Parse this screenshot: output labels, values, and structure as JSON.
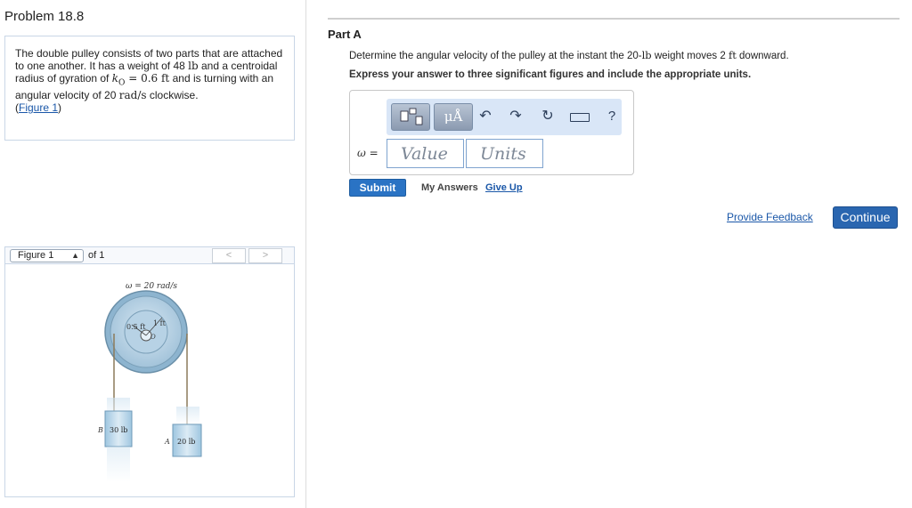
{
  "problem": {
    "title": "Problem 18.8",
    "text_part1": "The double pulley consists of two parts that are attached to one another. It has a weight of 48 ",
    "weight_unit": "lb",
    "text_part2": " and a centroidal radius of gyration of ",
    "k_symbol": "k",
    "k_sub": "O",
    "k_value": " = 0.6 ft",
    "text_part3": " and is turning with an angular velocity of 20 ",
    "omega_unit": "rad/s",
    "text_part4": " clockwise.",
    "figure_link_open": "(",
    "figure_link": "Figure 1",
    "figure_link_close": ")"
  },
  "figure_nav": {
    "select_value": "Figure 1",
    "of_text": "of 1",
    "prev": "<",
    "next": ">"
  },
  "figure": {
    "omega_label": "ω = 20 rad/s",
    "inner_radius_label": "0.5 ft",
    "outer_radius_label": "1 ft",
    "center_label": "O",
    "block_b_label": "B",
    "block_b_weight": "30 lb",
    "block_a_label": "A",
    "block_a_weight": "20 lb"
  },
  "part": {
    "label": "Part A",
    "question_part1": "Determine the angular velocity of the pulley at the instant the 20-",
    "question_unit1": "lb",
    "question_part2": " weight moves 2 ",
    "question_unit2": "ft",
    "question_part3": " downward.",
    "instruction": "Express your answer to three significant figures and include the appropriate units."
  },
  "toolbar": {
    "units_button": "μÅ",
    "undo_icon": "undo-icon",
    "redo_icon": "redo-icon",
    "reset_icon": "reset-icon",
    "keyboard_icon": "keyboard-icon",
    "help": "?"
  },
  "answer": {
    "variable_label": "ω =",
    "value_placeholder": "Value",
    "units_placeholder": "Units"
  },
  "actions": {
    "submit": "Submit",
    "my_answers": "My Answers",
    "give_up": "Give Up",
    "provide_feedback": "Provide Feedback",
    "continue": "Continue"
  },
  "colors": {
    "link": "#1a57a8",
    "primary_button": "#2a73c4",
    "toolbar_bg": "#d9e6f7"
  }
}
